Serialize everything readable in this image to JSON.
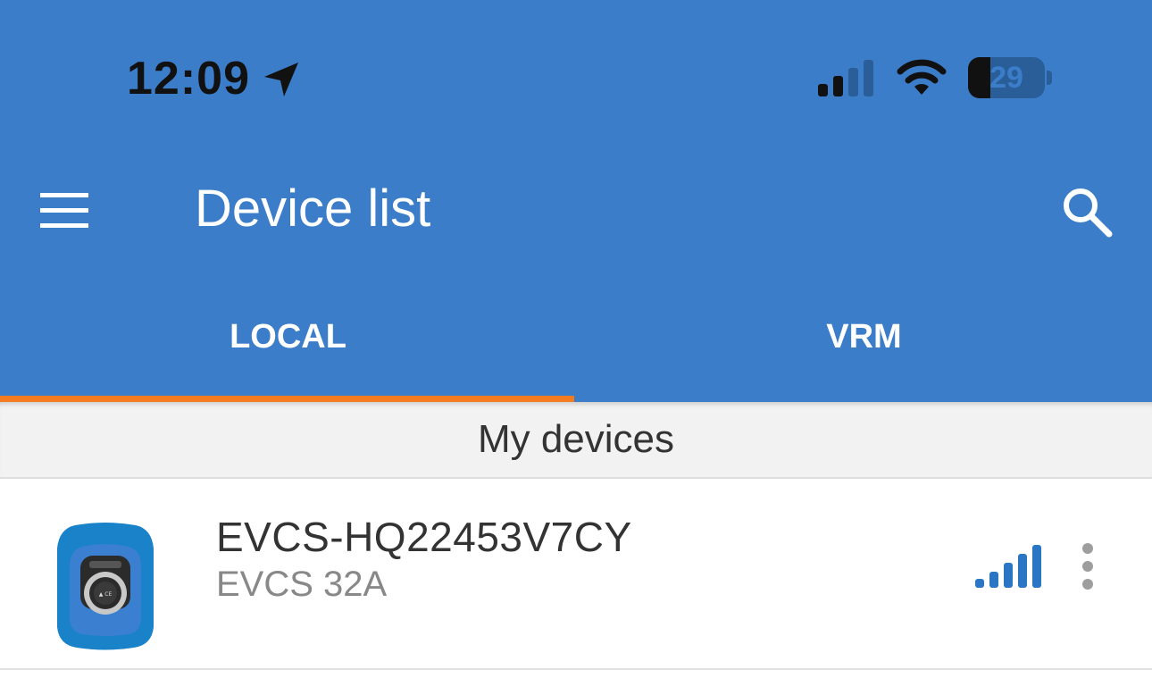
{
  "status_bar": {
    "time": "12:09",
    "battery_level": "29",
    "battery_fraction": 0.29,
    "icons": [
      "location-arrow-icon",
      "cellular-signal-icon",
      "wifi-icon",
      "battery-icon"
    ]
  },
  "toolbar": {
    "title": "Device list",
    "menu_icon": "hamburger-menu-icon",
    "search_icon": "search-icon",
    "background_color": "#3b7dc9"
  },
  "tabs": [
    {
      "label": "LOCAL",
      "selected": true
    },
    {
      "label": "VRM",
      "selected": false
    }
  ],
  "tab_indicator_color": "#f47b20",
  "section": {
    "title": "My devices"
  },
  "devices": [
    {
      "name": "EVCS-HQ22453V7CY",
      "model": "EVCS 32A",
      "icon": "ev-charger-icon",
      "signal_icon": "signal-strength-icon",
      "signal_strength": "5 of 5",
      "more_icon": "more-options-icon"
    }
  ]
}
